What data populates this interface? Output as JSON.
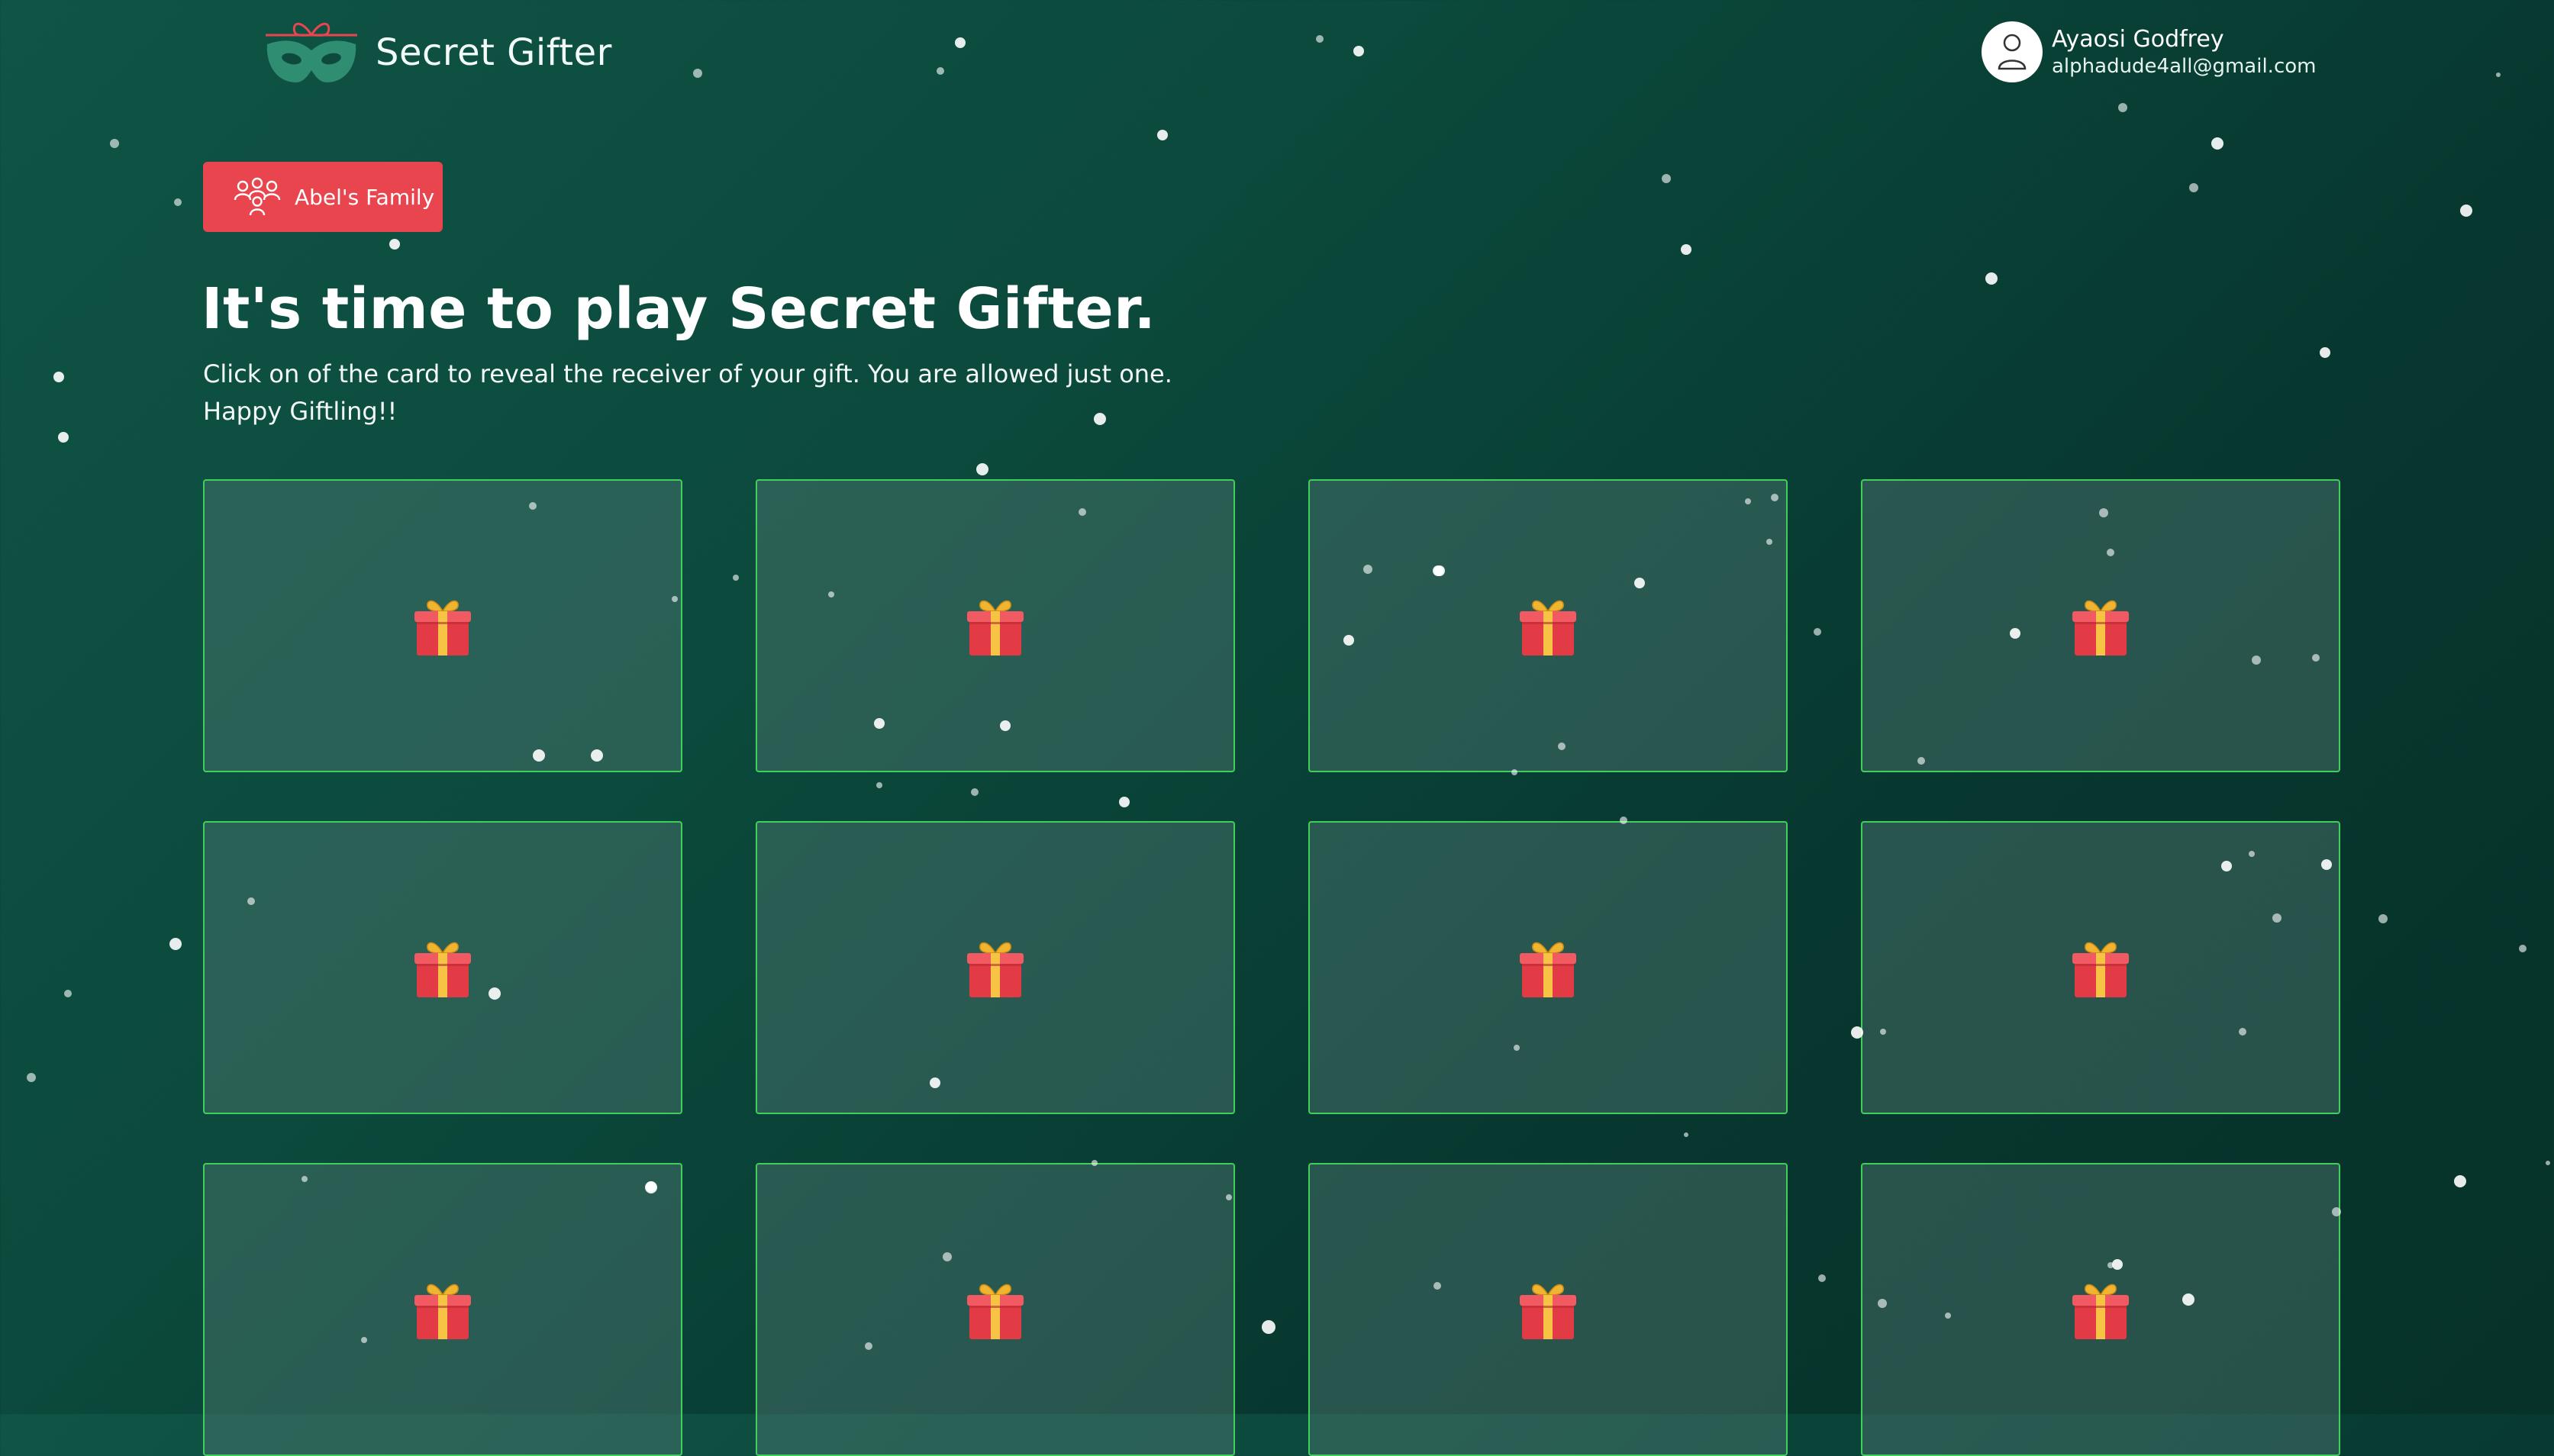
{
  "app": {
    "title": "Secret Gifter",
    "logo_icon": "mask-with-bow-icon"
  },
  "user": {
    "name": "Ayaosi Godfrey",
    "email": "alphadude4all@gmail.com",
    "avatar_icon": "user-avatar-icon"
  },
  "family": {
    "label": "Abel's Family",
    "icon": "family-group-icon"
  },
  "main": {
    "headline": "It's time to play Secret Gifter.",
    "instructions": "Click on of the card to reveal the receiver of your gift. You are allowed just one. Happy Giftling!!"
  },
  "cards": [
    {
      "icon": "gift-icon"
    },
    {
      "icon": "gift-icon"
    },
    {
      "icon": "gift-icon"
    },
    {
      "icon": "gift-icon"
    },
    {
      "icon": "gift-icon"
    },
    {
      "icon": "gift-icon"
    },
    {
      "icon": "gift-icon"
    },
    {
      "icon": "gift-icon"
    },
    {
      "icon": "gift-icon"
    },
    {
      "icon": "gift-icon"
    },
    {
      "icon": "gift-icon"
    },
    {
      "icon": "gift-icon"
    }
  ],
  "colors": {
    "background_top": "#0f5446",
    "background_bottom": "#063229",
    "accent_red": "#e9454f",
    "card_border": "#3fcf5a",
    "logo_mask": "#2f8d71"
  }
}
